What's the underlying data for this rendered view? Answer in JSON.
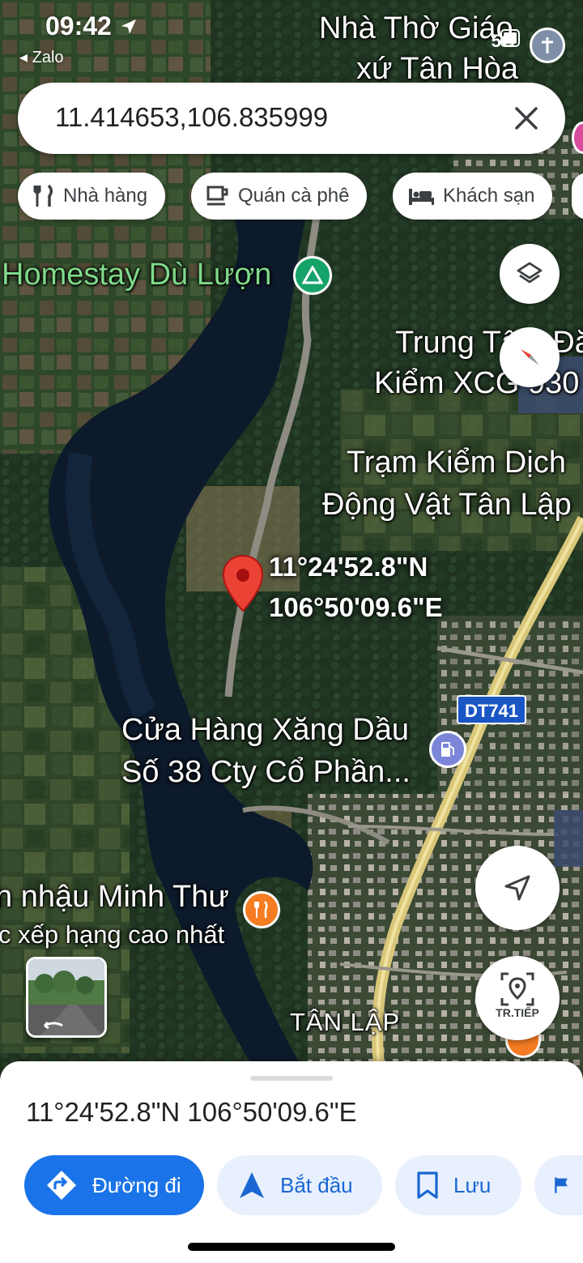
{
  "status_bar": {
    "time": "09:42",
    "back_app": "Zalo",
    "network": "5G"
  },
  "search": {
    "query": "11.414653,106.835999"
  },
  "chips": [
    {
      "label": "Nhà hàng",
      "icon": "restaurant-icon"
    },
    {
      "label": "Quán cà phê",
      "icon": "coffee-icon"
    },
    {
      "label": "Khách sạn",
      "icon": "hotel-icon"
    }
  ],
  "map": {
    "labels": {
      "church_line1": "Nhà Thờ Giáo",
      "church_line2": "xứ Tân Hòa",
      "homestay": "Homestay Dù Lượn",
      "inspection_line1": "Trung Tâm Đă",
      "inspection_line2": "Kiểm XCG 930",
      "quarantine_line1": "Trạm Kiểm Dịch",
      "quarantine_line2": "Động Vật Tân Lập",
      "gas_line1": "Cửa Hàng Xăng Dầu",
      "gas_line2": "Số 38 Cty Cổ Phần...",
      "restaurant_line1": "n nhậu Minh Thư",
      "restaurant_line2": "c xếp hạng cao nhất",
      "village": "TÂN LẬP"
    },
    "pin_coords_line1": "11°24'52.8\"N",
    "pin_coords_line2": "106°50'09.6\"E",
    "road_shield": "DT741",
    "live_view_label": "TR.TIẾP",
    "colors": {
      "pin": "#ea4335",
      "water": "#0d1a2b",
      "road": "#d9c77a",
      "shield": "#1a56c4"
    }
  },
  "sheet": {
    "title": "11°24'52.8\"N 106°50'09.6\"E",
    "actions": [
      {
        "label": "Đường đi",
        "icon": "directions-icon"
      },
      {
        "label": "Bắt đầu",
        "icon": "navigation-arrow-icon"
      },
      {
        "label": "Lưu",
        "icon": "bookmark-icon"
      }
    ]
  }
}
